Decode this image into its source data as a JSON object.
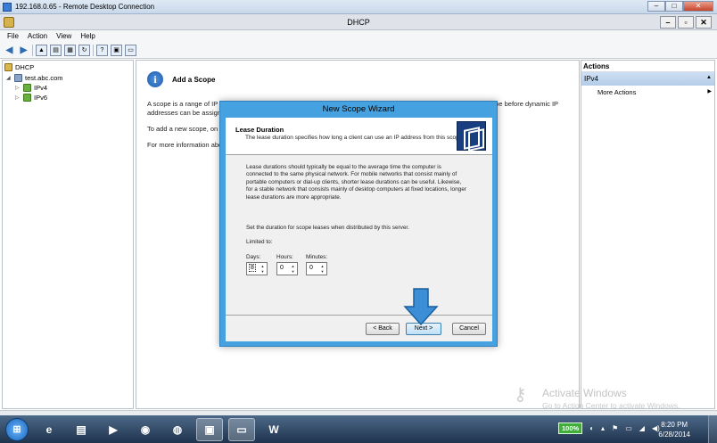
{
  "rdp": {
    "title": "192.168.0.65 - Remote Desktop Connection",
    "min": "–",
    "restore": "□",
    "close": "✕"
  },
  "window": {
    "title": "DHCP",
    "min": "–",
    "restore": "▫",
    "close": "✕"
  },
  "menu": [
    "File",
    "Action",
    "View",
    "Help"
  ],
  "toolbar_icons": [
    "back-arrow-icon",
    "forward-arrow-icon",
    "up-folder-icon",
    "show-hide-tree-icon",
    "export-icon",
    "refresh-icon",
    "help-icon",
    "properties-icon",
    "console-icon"
  ],
  "tree": {
    "root": "DHCP",
    "server": "test.abc.com",
    "ipv4": "IPv4",
    "ipv6": "IPv6"
  },
  "center": {
    "heading": "Add a Scope",
    "p1": "A scope is a range of IP ad",
    "p1b": "addresses can be assigned",
    "p1_right": "ope before dynamic IP",
    "p2": "To add a new scope, on th",
    "p3": "For more information abou"
  },
  "actions": {
    "header": "Actions",
    "selected": "IPv4",
    "item": "More Actions"
  },
  "wizard": {
    "title": "New Scope Wizard",
    "section_title": "Lease Duration",
    "section_subtitle": "The lease duration specifies how long a client can use an IP address from this scope.",
    "body": "Lease durations should typically be equal to the average time the computer is connected to the same physical network. For mobile networks that consist mainly of portable computers or dial-up clients, shorter lease durations can be useful. Likewise, for a stable network that consists mainly of desktop computers at fixed locations, longer lease durations are more appropriate.",
    "set_text": "Set the duration for scope leases when distributed by this server.",
    "limited_to": "Limited to:",
    "days_label": "Days:",
    "hours_label": "Hours:",
    "minutes_label": "Minutes:",
    "days": "8",
    "hours": "0",
    "minutes": "0",
    "back": "< Back",
    "next": "Next >",
    "cancel": "Cancel"
  },
  "watermark": {
    "line1": "Activate Windows",
    "line2": "Go to Action Center to activate Windows."
  },
  "taskbar": {
    "apps": [
      "ie-icon",
      "explorer-icon",
      "media-player-icon",
      "security-icon",
      "chrome-icon",
      "folder-icon",
      "remote-desktop-icon",
      "word-icon"
    ],
    "battery": "100%",
    "time": "8:20 PM",
    "date": "6/28/2014"
  },
  "colors": {
    "wizard_frame": "#45a1e0",
    "annotation_arrow": "#3c8fd6"
  }
}
